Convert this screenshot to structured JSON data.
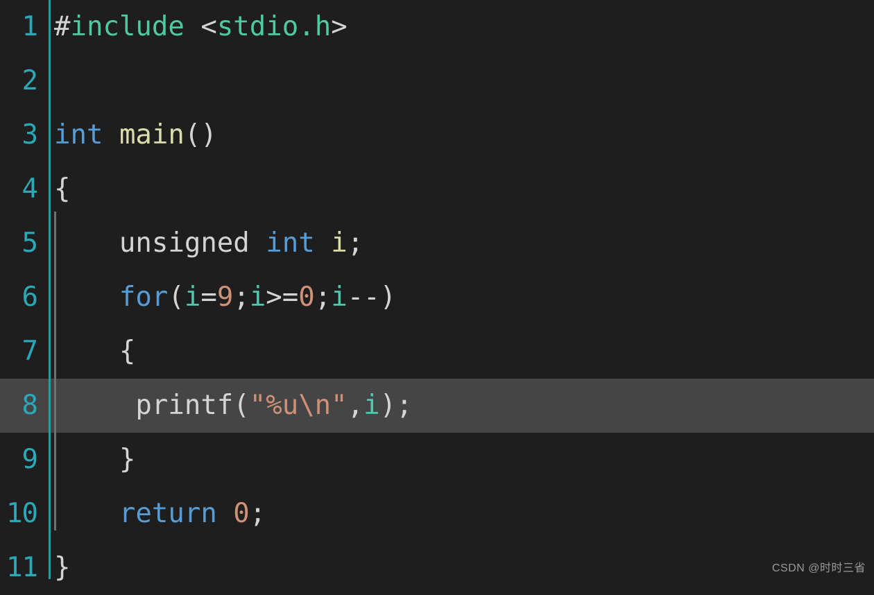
{
  "editor": {
    "background_color": "#1e1e1e",
    "highlight_color": "#454545",
    "line_number_color": "#2ba8b8",
    "scope_line_color": "#2b9aa8",
    "indent_guide_color": "#707070",
    "language": "c",
    "highlighted_line": 8,
    "total_lines": 11
  },
  "palette": {
    "plain": "#d4d4d4",
    "preprocessor_green": "#4ec9a0",
    "keyword_blue": "#569cd6",
    "function_yellow": "#dcdcaa",
    "variable_teal": "#4ec9b0",
    "number_salmon": "#ce9178",
    "string_salmon": "#ce9178"
  },
  "lines": [
    {
      "number": "1",
      "tokens": [
        {
          "text": "#",
          "kind": "plain"
        },
        {
          "text": "include",
          "kind": "green"
        },
        {
          "text": " <",
          "kind": "plain"
        },
        {
          "text": "stdio.h",
          "kind": "green"
        },
        {
          "text": ">",
          "kind": "plain"
        }
      ]
    },
    {
      "number": "2",
      "tokens": []
    },
    {
      "number": "3",
      "tokens": [
        {
          "text": "int",
          "kind": "keyword"
        },
        {
          "text": " ",
          "kind": "plain"
        },
        {
          "text": "main",
          "kind": "func"
        },
        {
          "text": "()",
          "kind": "plain"
        }
      ]
    },
    {
      "number": "4",
      "tokens": [
        {
          "text": "{",
          "kind": "plain"
        }
      ]
    },
    {
      "number": "5",
      "tokens": [
        {
          "text": "    unsigned ",
          "kind": "plain"
        },
        {
          "text": "int",
          "kind": "keyword"
        },
        {
          "text": " ",
          "kind": "plain"
        },
        {
          "text": "i",
          "kind": "func"
        },
        {
          "text": ";",
          "kind": "plain"
        }
      ]
    },
    {
      "number": "6",
      "tokens": [
        {
          "text": "    ",
          "kind": "plain"
        },
        {
          "text": "for",
          "kind": "keyword"
        },
        {
          "text": "(",
          "kind": "plain"
        },
        {
          "text": "i",
          "kind": "var"
        },
        {
          "text": "=",
          "kind": "plain"
        },
        {
          "text": "9",
          "kind": "number"
        },
        {
          "text": ";",
          "kind": "plain"
        },
        {
          "text": "i",
          "kind": "var"
        },
        {
          "text": ">=",
          "kind": "plain"
        },
        {
          "text": "0",
          "kind": "number"
        },
        {
          "text": ";",
          "kind": "plain"
        },
        {
          "text": "i",
          "kind": "var"
        },
        {
          "text": "--)",
          "kind": "plain"
        }
      ]
    },
    {
      "number": "7",
      "tokens": [
        {
          "text": "    {",
          "kind": "plain"
        }
      ]
    },
    {
      "number": "8",
      "tokens": [
        {
          "text": "     printf(",
          "kind": "plain"
        },
        {
          "text": "\"%u\\n\"",
          "kind": "string"
        },
        {
          "text": ",",
          "kind": "plain"
        },
        {
          "text": "i",
          "kind": "var"
        },
        {
          "text": ");",
          "kind": "plain"
        }
      ]
    },
    {
      "number": "9",
      "tokens": [
        {
          "text": "    }",
          "kind": "plain"
        }
      ]
    },
    {
      "number": "10",
      "tokens": [
        {
          "text": "    ",
          "kind": "plain"
        },
        {
          "text": "return",
          "kind": "keyword"
        },
        {
          "text": " ",
          "kind": "plain"
        },
        {
          "text": "0",
          "kind": "number"
        },
        {
          "text": ";",
          "kind": "plain"
        }
      ]
    },
    {
      "number": "11",
      "tokens": [
        {
          "text": "}",
          "kind": "plain"
        }
      ]
    }
  ],
  "watermark": {
    "text": "CSDN @时时三省"
  }
}
